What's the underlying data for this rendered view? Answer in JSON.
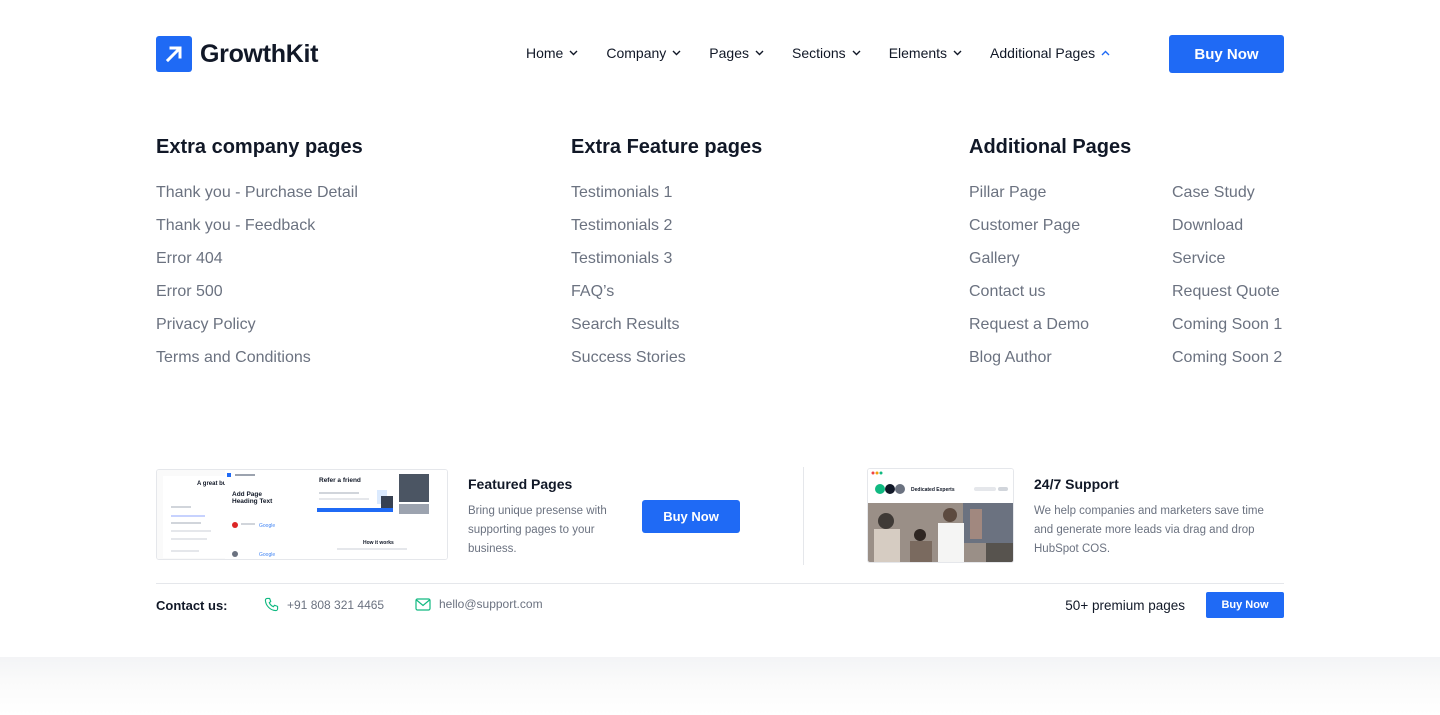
{
  "brand": {
    "name": "GrowthKit",
    "accent": "#1f6af5"
  },
  "nav": {
    "items": [
      {
        "label": "Home",
        "icon": "chevron-down-icon"
      },
      {
        "label": "Company",
        "icon": "chevron-down-icon"
      },
      {
        "label": "Pages",
        "icon": "chevron-down-icon"
      },
      {
        "label": "Sections",
        "icon": "chevron-down-icon"
      },
      {
        "label": "Elements",
        "icon": "chevron-down-icon"
      },
      {
        "label": "Additional Pages",
        "icon": "chevron-up-icon",
        "active": true
      }
    ],
    "buy_label": "Buy Now"
  },
  "mega_menu": {
    "company": {
      "title": "Extra company pages",
      "links": [
        "Thank you - Purchase Detail",
        "Thank you - Feedback",
        "Error 404",
        "Error 500",
        "Privacy Policy",
        "Terms and Conditions"
      ]
    },
    "feature": {
      "title": "Extra Feature pages",
      "links": [
        "Testimonials 1",
        "Testimonials 2",
        "Testimonials 3",
        "FAQ’s",
        "Search Results",
        "Success Stories"
      ]
    },
    "additional": {
      "title": "Additional Pages",
      "links_left": [
        "Pillar Page",
        "Customer Page",
        "Gallery",
        "Contact us",
        "Request a Demo",
        "Blog Author"
      ],
      "links_right": [
        "Case Study",
        "Download",
        "Service",
        "Request Quote",
        "Coming Soon 1",
        "Coming Soon 2"
      ]
    }
  },
  "promos": {
    "featured": {
      "title": "Featured Pages",
      "description": "Bring unique presense with supporting pages to your business.",
      "button": "Buy Now",
      "thumb": {
        "a_great": "A great bu",
        "add_page": "Add Page",
        "heading_text": "Heading Text",
        "refer": "Refer a friend",
        "how_it_works": "How it works",
        "google": "Google"
      }
    },
    "support": {
      "title": "24/7 Support",
      "description": "We help companies and marketers save time and generate more leads via drag and drop HubSpot COS.",
      "thumb": {
        "caption": "Dedicated Experts"
      }
    }
  },
  "footer": {
    "contact_label": "Contact us:",
    "phone": "+91 808 321 4465",
    "email": "hello@support.com",
    "premium": "50+ premium pages",
    "buy_label": "Buy Now"
  }
}
